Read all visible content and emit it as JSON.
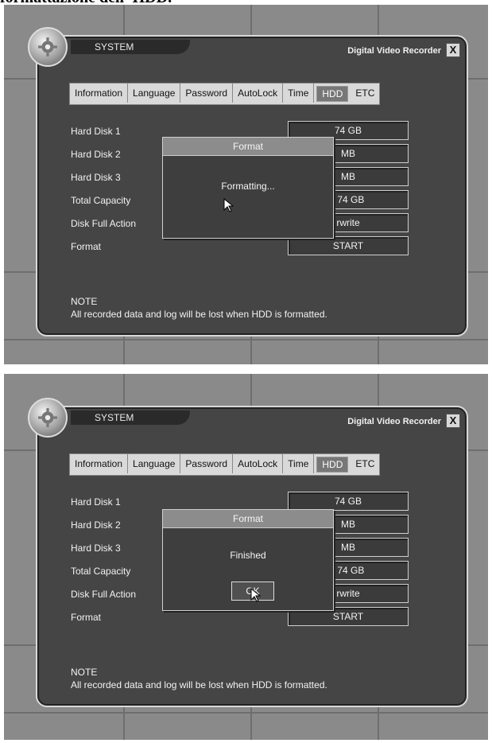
{
  "caption": "formattazione dell' HDD.",
  "panels": [
    {
      "system_tab": "SYSTEM",
      "window_title": "Digital Video Recorder",
      "close_label": "X",
      "tabs": [
        "Information",
        "Language",
        "Password",
        "AutoLock",
        "Time",
        "HDD",
        "ETC"
      ],
      "active_tab": "HDD",
      "rows": [
        {
          "label": "Hard Disk 1",
          "value": "74 GB"
        },
        {
          "label": "Hard Disk 2",
          "value": "MB"
        },
        {
          "label": "Hard Disk 3",
          "value": "MB"
        },
        {
          "label": "Total Capacity",
          "value": "/ 74 GB"
        },
        {
          "label": "Disk Full Action",
          "value": "rwrite"
        },
        {
          "label": "Format",
          "value": "START"
        }
      ],
      "note_title": "NOTE",
      "note_text": "All recorded data and log will be lost when HDD is formatted.",
      "dialog": {
        "title": "Format",
        "message": "Formatting..."
      }
    },
    {
      "system_tab": "SYSTEM",
      "window_title": "Digital Video Recorder",
      "close_label": "X",
      "tabs": [
        "Information",
        "Language",
        "Password",
        "AutoLock",
        "Time",
        "HDD",
        "ETC"
      ],
      "active_tab": "HDD",
      "rows": [
        {
          "label": "Hard Disk 1",
          "value": "74 GB"
        },
        {
          "label": "Hard Disk 2",
          "value": "MB"
        },
        {
          "label": "Hard Disk 3",
          "value": "MB"
        },
        {
          "label": "Total Capacity",
          "value": "/ 74 GB"
        },
        {
          "label": "Disk Full Action",
          "value": "rwrite"
        },
        {
          "label": "Format",
          "value": "START"
        }
      ],
      "note_title": "NOTE",
      "note_text": "All recorded data and log will be lost when HDD is formatted.",
      "dialog": {
        "title": "Format",
        "message": "Finished",
        "ok_label": "OK"
      }
    }
  ],
  "colors": {
    "panel_bg": "#454545",
    "screen_bg": "#8a8a8a",
    "dialog_title": "#8c8c8c"
  },
  "icons": {
    "gear": "gear-icon",
    "cursor": "mouse-pointer-icon"
  }
}
